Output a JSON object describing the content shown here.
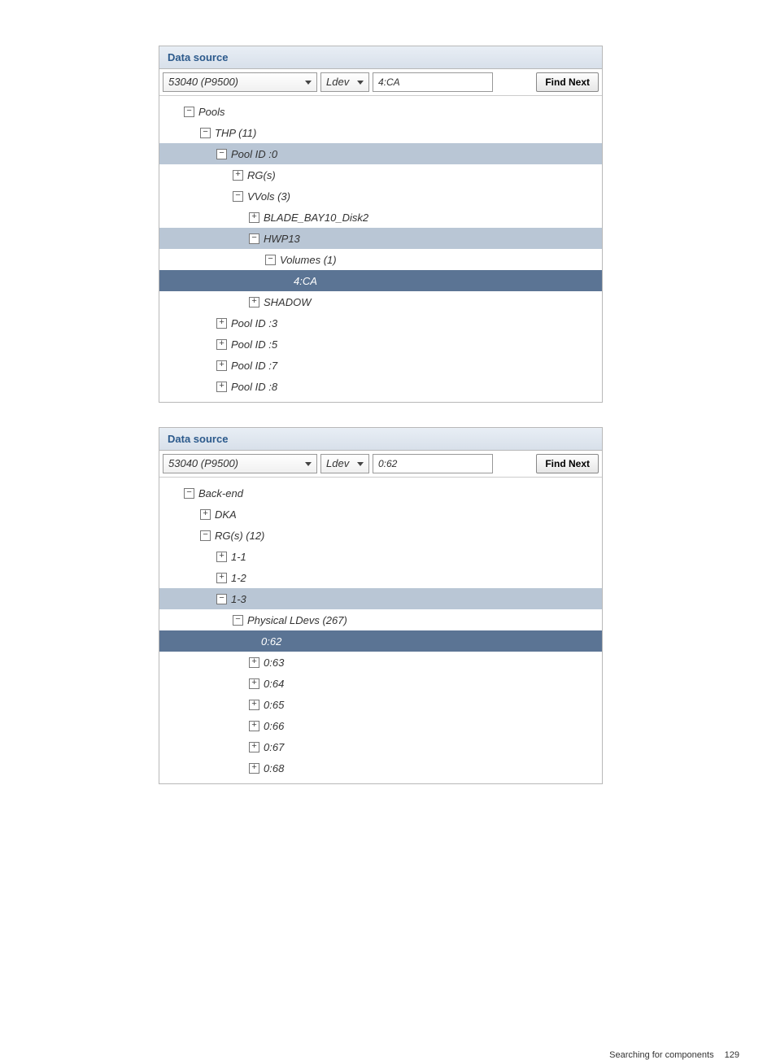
{
  "panel1": {
    "title": "Data source",
    "device": "53040 (P9500)",
    "searchType": "Ldev",
    "searchValue": "4:CA",
    "findNext": "Find Next",
    "tree": [
      {
        "indent": 1,
        "expand": "minus",
        "label": "Pools",
        "hl": false
      },
      {
        "indent": 2,
        "expand": "minus",
        "label": "THP (11)",
        "hl": false
      },
      {
        "indent": 3,
        "expand": "minus",
        "label": "Pool ID :0",
        "hl": true
      },
      {
        "indent": 4,
        "expand": "plus",
        "label": "RG(s)",
        "hl": false
      },
      {
        "indent": 4,
        "expand": "minus",
        "label": "VVols (3)",
        "hl": false
      },
      {
        "indent": 5,
        "expand": "plus",
        "label": "BLADE_BAY10_Disk2",
        "hl": false
      },
      {
        "indent": 5,
        "expand": "minus",
        "label": "HWP13",
        "hl": true
      },
      {
        "indent": 6,
        "expand": "minus",
        "label": "Volumes (1)",
        "hl": false
      },
      {
        "indent": 7,
        "expand": "leaf",
        "label": "4:CA",
        "hl": true,
        "sel": true
      },
      {
        "indent": 5,
        "expand": "plus",
        "label": "SHADOW",
        "hl": false
      },
      {
        "indent": 3,
        "expand": "plus",
        "label": "Pool ID :3",
        "hl": false
      },
      {
        "indent": 3,
        "expand": "plus",
        "label": "Pool ID :5",
        "hl": false
      },
      {
        "indent": 3,
        "expand": "plus",
        "label": "Pool ID :7",
        "hl": false
      },
      {
        "indent": 3,
        "expand": "plus",
        "label": "Pool ID :8",
        "hl": false
      }
    ]
  },
  "panel2": {
    "title": "Data source",
    "device": "53040 (P9500)",
    "searchType": "Ldev",
    "searchValue": "0:62",
    "findNext": "Find Next",
    "tree": [
      {
        "indent": 1,
        "expand": "minus",
        "label": "Back-end",
        "hl": false
      },
      {
        "indent": 2,
        "expand": "plus",
        "label": "DKA",
        "hl": false
      },
      {
        "indent": 2,
        "expand": "minus",
        "label": "RG(s) (12)",
        "hl": false
      },
      {
        "indent": 3,
        "expand": "plus",
        "label": "1-1",
        "hl": false
      },
      {
        "indent": 3,
        "expand": "plus",
        "label": "1-2",
        "hl": false
      },
      {
        "indent": 3,
        "expand": "minus",
        "label": "1-3",
        "hl": true
      },
      {
        "indent": 4,
        "expand": "minus",
        "label": "Physical LDevs (267)",
        "hl": false
      },
      {
        "indent": 5,
        "expand": "leaf",
        "label": "0:62",
        "hl": true,
        "sel": true
      },
      {
        "indent": 5,
        "expand": "plus",
        "label": "0:63",
        "hl": false
      },
      {
        "indent": 5,
        "expand": "plus",
        "label": "0:64",
        "hl": false
      },
      {
        "indent": 5,
        "expand": "plus",
        "label": "0:65",
        "hl": false
      },
      {
        "indent": 5,
        "expand": "plus",
        "label": "0:66",
        "hl": false
      },
      {
        "indent": 5,
        "expand": "plus",
        "label": "0:67",
        "hl": false
      },
      {
        "indent": 5,
        "expand": "plus",
        "label": "0:68",
        "hl": false
      }
    ]
  },
  "footer": {
    "section": "Searching for components",
    "page": "129"
  }
}
